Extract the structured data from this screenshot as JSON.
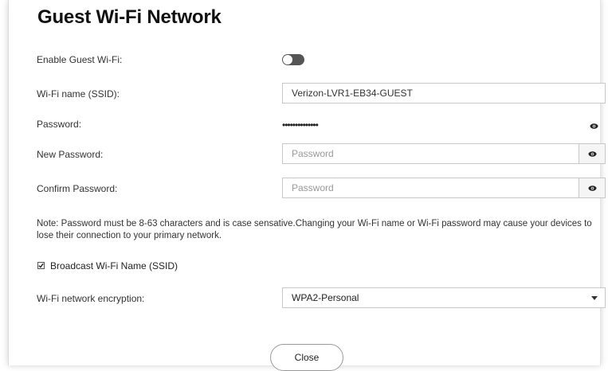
{
  "dialog": {
    "title": "Guest Wi-Fi Network"
  },
  "form": {
    "enable_label": "Enable Guest Wi-Fi:",
    "enable_on": false,
    "ssid_label": "Wi-Fi name (SSID):",
    "ssid_value": "Verizon-LVR1-EB34-GUEST",
    "password_label": "Password:",
    "password_masked": "••••••••••••••",
    "new_password_label": "New Password:",
    "new_password_placeholder": "Password",
    "confirm_password_label": "Confirm Password:",
    "confirm_password_placeholder": "Password",
    "note": "Note: Password must be 8-63 characters and is case sensative.Changing your Wi-Fi name or Wi-Fi password may cause your devices to lose their connection to your primary network.",
    "broadcast_label": "Broadcast Wi-Fi Name (SSID)",
    "broadcast_checked": true,
    "encryption_label": "Wi-Fi network encryption:",
    "encryption_value": "WPA2-Personal"
  },
  "footer": {
    "close_label": "Close"
  },
  "icons": {
    "eye": "eye-icon",
    "dropdown": "chevron-down-icon"
  }
}
